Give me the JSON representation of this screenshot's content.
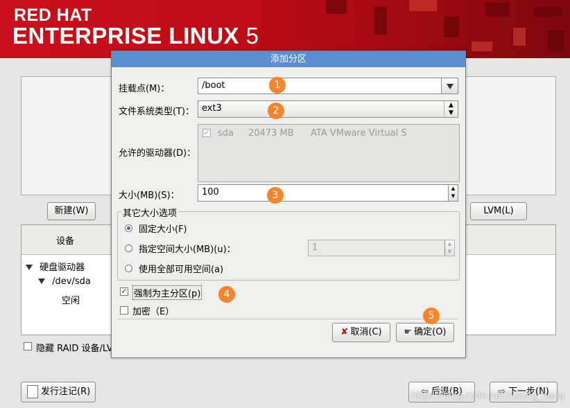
{
  "banner": {
    "line1": "RED HAT",
    "line2": "ENTERPRISE LINUX",
    "version": "5"
  },
  "main": {
    "new_button": "新建(W)",
    "lvm_button": "LVM(L)",
    "tree": {
      "column_device": "设备",
      "items": [
        "硬盘驱动器",
        "/dev/sda",
        "空闲"
      ]
    },
    "hide_raid_label": "隐藏 RAID 设备/LV"
  },
  "dialog": {
    "title": "添加分区",
    "mount_label": "挂载点(M)：",
    "mount_value": "/boot",
    "fstype_label": "文件系统类型(T)：",
    "fstype_value": "ext3",
    "drives_label": "允许的驱动器(D)：",
    "drive": {
      "name": "sda",
      "size": "20473 MB",
      "model": "ATA VMware Virtual S"
    },
    "size_label": "大小(MB)(S)：",
    "size_value": "100",
    "other_size_legend": "其它大小选项",
    "opt_fixed": "固定大小(F)",
    "opt_upto": "指定空间大小(MB)(u)：",
    "opt_upto_value": "1",
    "opt_fill": "使用全部可用空间(a)",
    "primary_label": "强制为主分区(p)",
    "encrypt_label": "加密（E）",
    "cancel_button": "取消(C)",
    "ok_button": "确定(O)"
  },
  "badges": [
    "1",
    "2",
    "3",
    "4",
    "5"
  ],
  "footer": {
    "release_notes_button": "发行注记(R)",
    "back_button": "后退(B)",
    "next_button": "下一步(N)",
    "watermark": "https://blog.csdn.net/liuxing_hang"
  }
}
